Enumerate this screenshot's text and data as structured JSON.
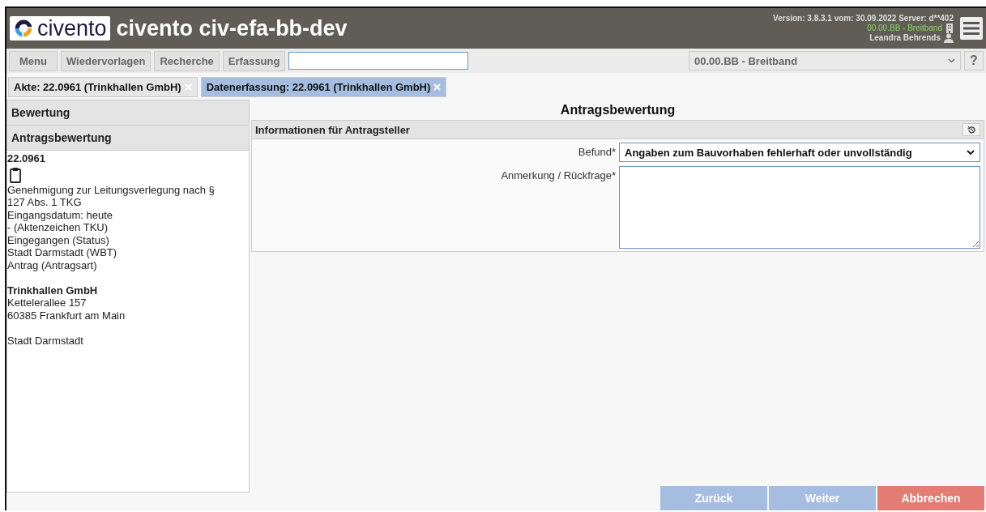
{
  "header": {
    "logo_text": "civento",
    "title": "civento civ-efa-bb-dev",
    "version": "Version: 3.8.3.1 vom: 30.09.2022 Server: d**402",
    "unit": "00.00.BB - Breitband",
    "user": "Leandra Behrends"
  },
  "toolbar": {
    "buttons": [
      "Menu",
      "Wiedervorlagen",
      "Recherche",
      "Erfassung"
    ],
    "search": {
      "kind": "input"
    },
    "unit_select": {
      "value": "00.00.BB - Breitband"
    },
    "help": "?"
  },
  "tabs": [
    {
      "label": "Akte: 22.0961 (Trinkhallen GmbH)",
      "selected": false
    },
    {
      "label": "Datenerfassung: 22.0961 (Trinkhallen GmbH)",
      "selected": true
    }
  ],
  "sidebar": {
    "sections": [
      "Bewertung",
      "Antragsbewertung"
    ],
    "case_number": "22.0961",
    "details": [
      "Genehmigung zur Leitungsverlegung nach § 127 Abs. 1 TKG",
      "Eingangsdatum: heute",
      "- (Aktenzeichen TKU)",
      "Eingegangen (Status)",
      "Stadt Darmstadt (WBT)",
      "Antrag (Antragsart)"
    ],
    "company": "Trinkhallen GmbH",
    "address": [
      "Kettelerallee 157",
      "60385 Frankfurt am Main"
    ],
    "authority": "Stadt Darmstadt"
  },
  "main": {
    "title": "Antragsbewertung",
    "panel_title": "Informationen für Antragsteller",
    "fields": [
      {
        "kind": "select",
        "label": "Befund*",
        "value": "Angaben zum Bauvorhaben fehlerhaft oder unvollständig"
      },
      {
        "kind": "textarea",
        "label": "Anmerkung / Rückfrage*"
      }
    ]
  },
  "footer_buttons": [
    {
      "label": "Zurück",
      "kind": "nav"
    },
    {
      "label": "Weiter",
      "kind": "nav"
    },
    {
      "label": "Abbrechen",
      "kind": "cancel"
    }
  ]
}
